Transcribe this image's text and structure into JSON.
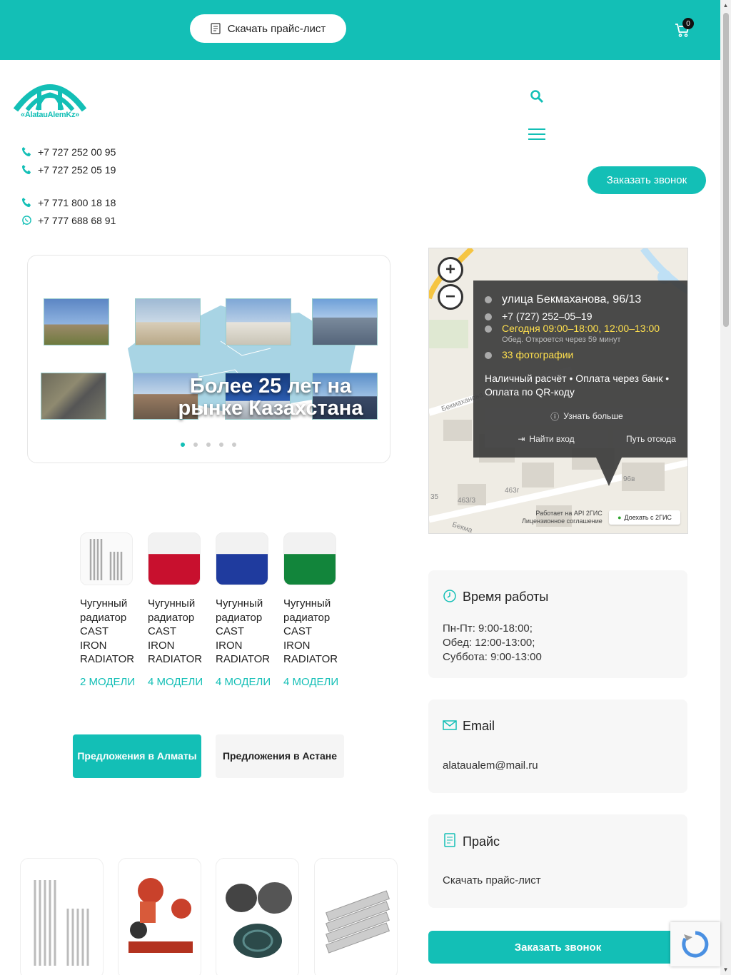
{
  "header": {
    "price_button": "Скачать прайс-лист",
    "cart_count": "0",
    "logo_text": "«AlatauAlemKz»",
    "callback_button": "Заказать звонок"
  },
  "phones": [
    {
      "number": "+7 727 252 00 95",
      "icon": "phone-icon"
    },
    {
      "number": "+7 727 252 05 19",
      "icon": "phone-icon"
    },
    {
      "number": "+7 771 800 18 18",
      "icon": "phone-icon"
    },
    {
      "number": "+7 777 688 68 91",
      "icon": "whatsapp-icon"
    }
  ],
  "slider": {
    "caption": "Более 25 лет на рынке Казахстана",
    "slide_count": 5,
    "active_index": 0
  },
  "map": {
    "address": "улица Бекмаханова, 96/13",
    "phone": "+7 (727) 252–05–19",
    "hours_today": "Сегодня 09:00–18:00, 12:00–13:00",
    "lunch_note": "Обед. Откроется через 59 минут",
    "photos": "33 фотографии",
    "payment": "Наличный расчёт • Оплата через банк • Оплата по QR-коду",
    "learn_more": "Узнать больше",
    "find_entrance": "Найти вход",
    "route_from": "Путь отсюда",
    "attribution_1": "Работает на API 2ГИС",
    "attribution_2": "Лицензионное соглашение",
    "drive_2gis": "Доехать с 2ГИС",
    "street_label": "Бекмаханова",
    "street_label_2": "Бекма",
    "b1": "463г",
    "b2": "463/3",
    "b3": "96в",
    "b4": "35"
  },
  "products": [
    {
      "name": "Чугунный радиатор CAST IRON RADIATOR",
      "models": "2 МОДЕЛИ",
      "color": "#ffffff"
    },
    {
      "name": "Чугунный радиатор CAST IRON RADIATOR",
      "models": "4 МОДЕЛИ",
      "color": "#c8102e"
    },
    {
      "name": "Чугунный радиатор CAST IRON RADIATOR",
      "models": "4 МОДЕЛИ",
      "color": "#1f3b9e"
    },
    {
      "name": "Чугунный радиатор CAST IRON RADIATOR",
      "models": "4 МОДЕЛИ",
      "color": "#12853b"
    }
  ],
  "tabs": {
    "almaty": "Предложения в Алматы",
    "astana": "Предложения в Астане"
  },
  "cards": {
    "hours_title": "Время работы",
    "hours_lines": [
      "Пн-Пт: 9:00-18:00;",
      "Обед: 12:00-13:00;",
      "Суббота: 9:00-13:00"
    ],
    "email_title": "Email",
    "email_value": "alataualem@mail.ru",
    "price_title": "Прайс",
    "price_link": "Скачать прайс-лист"
  },
  "callback_wide": "Заказать звонок",
  "colors": {
    "accent": "#13bfb6"
  }
}
